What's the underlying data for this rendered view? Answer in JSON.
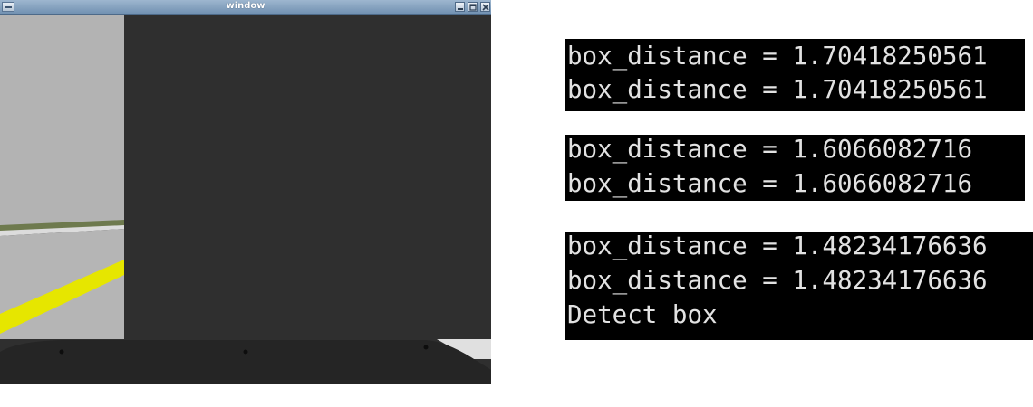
{
  "window": {
    "title": "window",
    "buttons": {
      "minimize": "minimize-icon",
      "maximize": "maximize-icon",
      "close": "close-icon"
    }
  },
  "terminals": [
    {
      "lines": [
        "box_distance = 1.70418250561",
        "box_distance = 1.70418250561"
      ]
    },
    {
      "lines": [
        "box_distance = 1.6066082716",
        "box_distance = 1.6066082716"
      ]
    },
    {
      "lines": [
        "box_distance = 1.48234176636",
        "box_distance = 1.48234176636",
        "Detect box"
      ]
    }
  ],
  "colors": {
    "wall": "#2f2f2f",
    "floor": "#b5b5b5",
    "lane_line": "#e6e600",
    "terminal_bg": "#000000",
    "terminal_text": "#e2e2e2"
  }
}
